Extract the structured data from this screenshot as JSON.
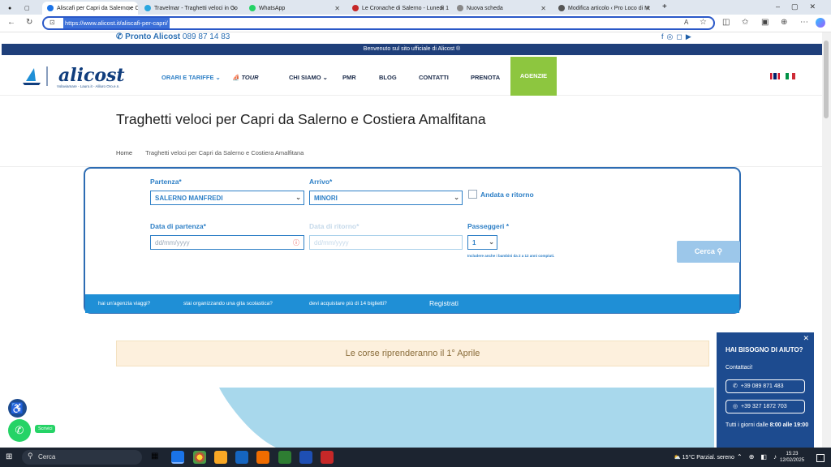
{
  "browser": {
    "tabs": [
      {
        "label": "Aliscafi per Capri da Salerno e Co",
        "active": true,
        "color": "#1a73e8"
      },
      {
        "label": "Travelmar - Traghetti veloci in Co",
        "active": false,
        "color": "#2aa6df"
      },
      {
        "label": "WhatsApp",
        "active": false,
        "color": "#25d366"
      },
      {
        "label": "Le Cronache di Salerno - Lunedì 1",
        "active": false,
        "color": "#c62828"
      },
      {
        "label": "Nuova scheda",
        "active": false,
        "color": "#888888"
      },
      {
        "label": "Modifica articolo ‹ Pro Loco di M",
        "active": false,
        "color": "#555555"
      }
    ],
    "url": "https://www.alicost.it/aliscafi-per-capri/"
  },
  "site": {
    "pronto_label": "Pronto Alicost",
    "pronto_number": "089 87 14 83",
    "banner": "Benvenuto sul sito ufficiale di Alicost ®",
    "logo_text": "alicost",
    "logo_tagline": "Volaviamare - Lauro.it - Aliluro Oro.e.n.",
    "nav": [
      "ORARI E TARIFFE",
      "TOUR",
      "CHI SIAMO",
      "PMR",
      "BLOG",
      "CONTATTI",
      "PRENOTA",
      "AGENZIE"
    ],
    "page_title": "Traghetti veloci per Capri da Salerno e Costiera Amalfitana",
    "breadcrumb_home": "Home",
    "breadcrumb_current": "Traghetti veloci per Capri da Salerno e Costiera Amalfitana"
  },
  "form": {
    "partenza_label": "Partenza*",
    "partenza_value": "SALERNO MANFREDI",
    "arrivo_label": "Arrivo*",
    "arrivo_value": "MINORI",
    "andata_ritorno": "Andata e ritorno",
    "data_partenza_label": "Data di partenza*",
    "data_partenza_placeholder": "dd/mm/yyyy",
    "data_ritorno_label": "Data di ritorno*",
    "data_ritorno_placeholder": "dd/mm/yyyy",
    "passeggeri_label": "Passeggeri *",
    "passeggeri_value": "1",
    "passeggeri_note": "Includere anche i bambini da 2 a 12 anni compiuti.",
    "search_button": "Cerca",
    "links": [
      "hai un'agenzia viaggi?",
      "stai organizzando una gita scolastica?",
      "devi acquistare più di 14 biglietti?"
    ],
    "register": "Registrati"
  },
  "notice": "Le corse riprenderanno il 1° Aprile",
  "help": {
    "title": "HAI BISOGNO DI AIUTO?",
    "contact": "Contattaci!",
    "phone": "+39 089 871 483",
    "whatsapp": "+39 327 1872 703",
    "hours_prefix": "Tutti i giorni dalle",
    "hours": "8:00 alle 19:00"
  },
  "whatsapp_label": "Scrivici",
  "taskbar": {
    "search": "Cerca",
    "weather": "15°C  Parzial. sereno",
    "time": "15:23",
    "date": "12/02/2025"
  }
}
